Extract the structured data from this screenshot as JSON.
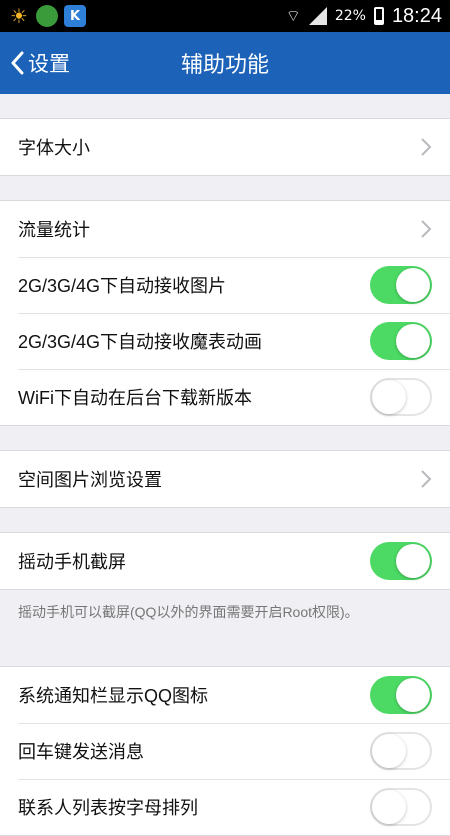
{
  "status": {
    "battery": "22%",
    "time": "18:24",
    "apps": [
      {
        "icon": "weather-icon",
        "color": "#f0b429"
      },
      {
        "icon": "app-icon",
        "color": "#3a9b3a"
      },
      {
        "icon": "k-app-icon",
        "text": "K",
        "color": "#2d7fd8"
      }
    ],
    "battery_level": 0.22
  },
  "nav": {
    "back_label": "设置",
    "title": "辅助功能"
  },
  "groups": [
    {
      "rows": [
        {
          "label": "字体大小",
          "type": "chevron"
        }
      ]
    },
    {
      "rows": [
        {
          "label": "流量统计",
          "type": "chevron"
        },
        {
          "label": "2G/3G/4G下自动接收图片",
          "type": "toggle",
          "on": true
        },
        {
          "label": "2G/3G/4G下自动接收魔表动画",
          "type": "toggle",
          "on": true
        },
        {
          "label": "WiFi下自动在后台下载新版本",
          "type": "toggle",
          "on": false
        }
      ]
    },
    {
      "rows": [
        {
          "label": "空间图片浏览设置",
          "type": "chevron"
        }
      ]
    },
    {
      "rows": [
        {
          "label": "摇动手机截屏",
          "type": "toggle",
          "on": true
        }
      ],
      "footnote": "摇动手机可以截屏(QQ以外的界面需要开启Root权限)。"
    },
    {
      "rows": [
        {
          "label": "系统通知栏显示QQ图标",
          "type": "toggle",
          "on": true
        },
        {
          "label": "回车键发送消息",
          "type": "toggle",
          "on": false
        },
        {
          "label": "联系人列表按字母排列",
          "type": "toggle",
          "on": false
        }
      ]
    }
  ],
  "colors": {
    "nav": "#1c62b9",
    "toggle_on": "#4cd964"
  }
}
